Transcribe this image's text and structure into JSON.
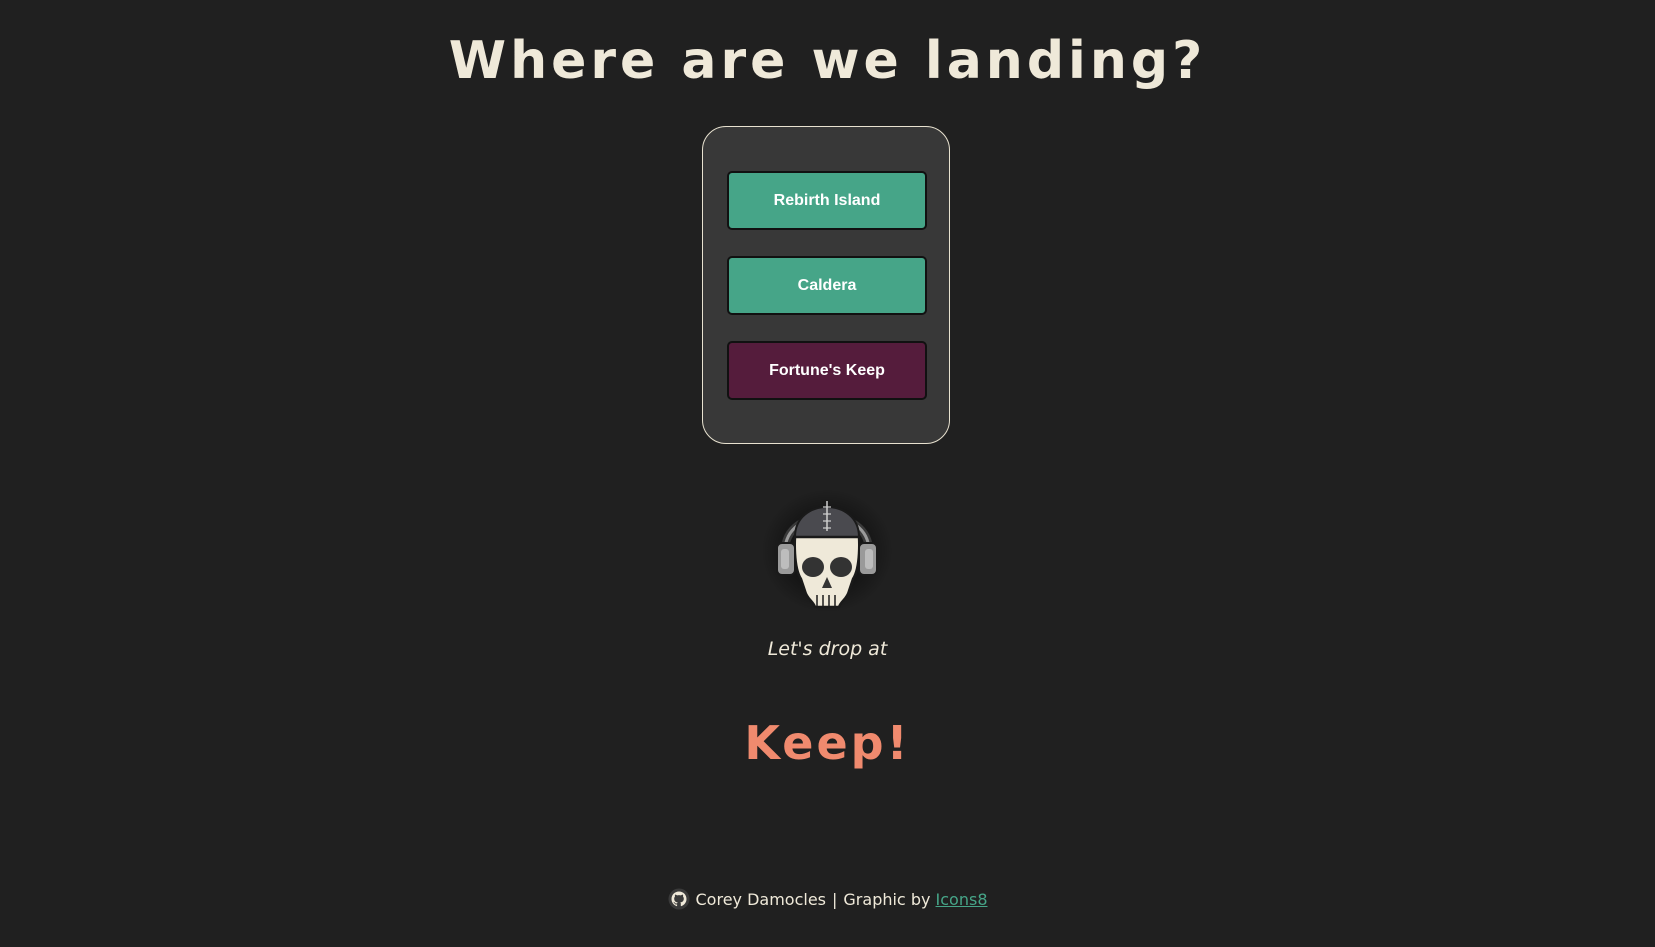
{
  "header": {
    "title": "Where are we landing?"
  },
  "maps": [
    {
      "label": "Rebirth Island",
      "color": "#46a588"
    },
    {
      "label": "Caldera",
      "color": "#46a588"
    },
    {
      "label": "Fortune's Keep",
      "color": "#551c3c"
    }
  ],
  "result": {
    "prefix": "Let's drop at",
    "value": "Keep!"
  },
  "footer": {
    "icon": "github-icon",
    "author": "Corey Damocles",
    "separator": "|",
    "credit_text": "Graphic by",
    "credit_link": "Icons8"
  },
  "colors": {
    "background": "#202020",
    "panel": "#383838",
    "accent_green": "#46a588",
    "accent_maroon": "#551c3c",
    "result": "#f08a6e",
    "text": "#efe9d9"
  },
  "graphic": {
    "icon": "skull-headphones-icon"
  }
}
